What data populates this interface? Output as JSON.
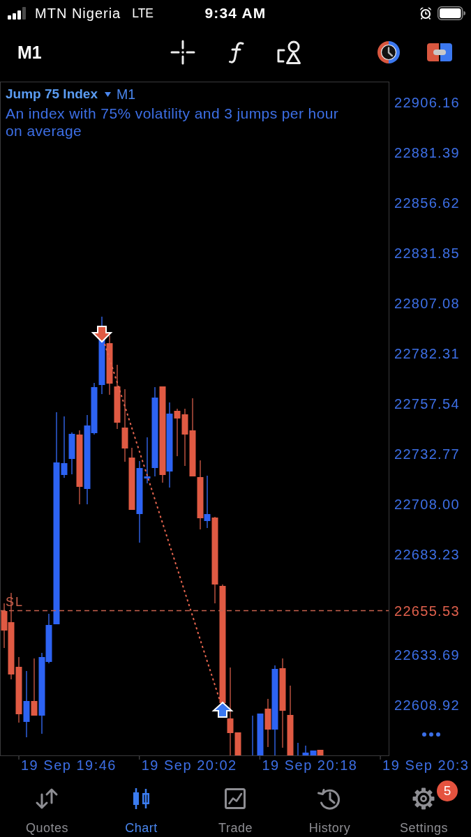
{
  "status_bar": {
    "carrier": "MTN Nigeria",
    "network": "LTE",
    "time": "9:34 AM"
  },
  "toolbar": {
    "timeframe": "M1"
  },
  "chart": {
    "symbol": "Jump 75 Index",
    "timeframe": "M1",
    "description": "An index with 75% volatility and 3 jumps per hour on average",
    "price_axis": [
      "22906.16",
      "22881.39",
      "22856.62",
      "22831.85",
      "22807.08",
      "22782.31",
      "22757.54",
      "22732.77",
      "22708.00",
      "22683.23",
      "22633.69",
      "22608.92"
    ],
    "stop_loss": {
      "label": "SL",
      "price": "22655.53"
    },
    "time_axis": [
      "19 Sep 19:46",
      "19 Sep 20:02",
      "19 Sep 20:18",
      "19 Sep 20:3"
    ]
  },
  "tabs": [
    {
      "label": "Quotes",
      "selected": false
    },
    {
      "label": "Chart",
      "selected": true
    },
    {
      "label": "Trade",
      "selected": false
    },
    {
      "label": "History",
      "selected": false
    },
    {
      "label": "Settings",
      "selected": false,
      "badge": "5"
    }
  ]
}
